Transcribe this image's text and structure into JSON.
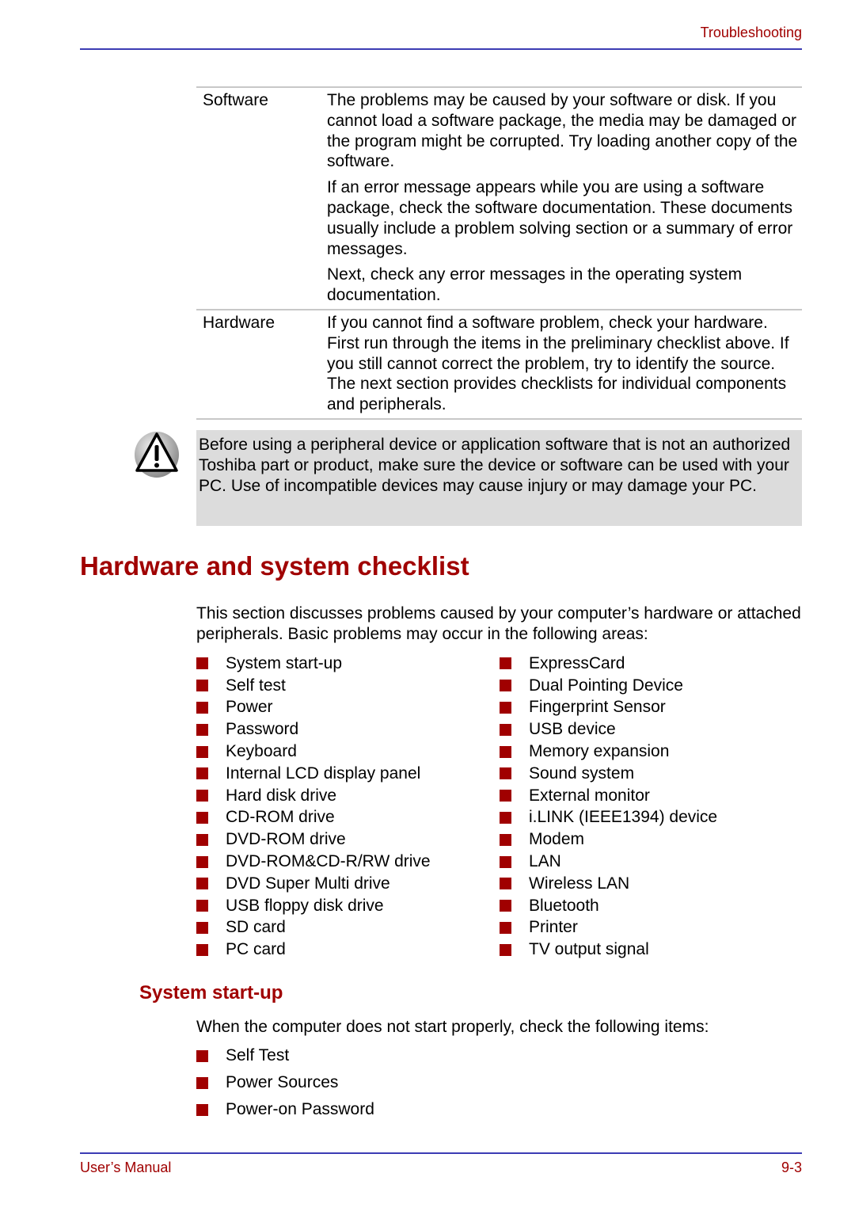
{
  "header": {
    "section_title": "Troubleshooting"
  },
  "table": {
    "rows": [
      {
        "label": "Software",
        "paragraphs": [
          "The problems may be caused by your software or disk. If you cannot load a software package, the media may be damaged or the program might be corrupted. Try loading another copy of the software.",
          "If an error message appears while you are using a software package, check the software documentation. These documents usually include a problem solving section or a summary of error messages.",
          "Next, check any error messages in the operating system documentation."
        ]
      },
      {
        "label": "Hardware",
        "paragraphs": [
          "If you cannot find a software problem, check your hardware. First run through the items in the preliminary checklist above. If you still cannot correct the problem, try to identify the source. The next section provides checklists for individual components and peripherals."
        ]
      }
    ]
  },
  "warning": {
    "icon": "warning-triangle-icon",
    "text": "Before using a peripheral device or application software that is not an authorized Toshiba part or product, make sure the device or software can be used with your PC. Use of incompatible devices may cause injury or may damage your PC."
  },
  "section": {
    "title": "Hardware and system checklist",
    "intro": "This section discusses problems caused by your computer’s hardware or attached peripherals. Basic problems may occur in the following areas:",
    "left_items": [
      "System start-up",
      "Self test",
      "Power",
      "Password",
      "Keyboard",
      "Internal LCD display panel",
      "Hard disk drive",
      "CD-ROM drive",
      "DVD-ROM drive",
      "DVD-ROM&CD-R/RW drive",
      "DVD Super Multi drive",
      "USB floppy disk drive",
      "SD card",
      "PC card"
    ],
    "right_items": [
      "ExpressCard",
      "Dual Pointing Device",
      "Fingerprint Sensor",
      "USB device",
      "Memory expansion",
      "Sound system",
      "External monitor",
      "i.LINK (IEEE1394) device",
      "Modem",
      "LAN",
      "Wireless LAN",
      "Bluetooth",
      "Printer",
      "TV output signal"
    ]
  },
  "subsection": {
    "title": "System start-up",
    "intro": "When the computer does not start properly, check the following items:",
    "items": [
      "Self Test",
      "Power Sources",
      "Power-on Password"
    ]
  },
  "footer": {
    "left": "User’s Manual",
    "page": "9-3"
  },
  "colors": {
    "accent": "#a00000",
    "rule": "#3c3cb4",
    "note_bg": "#dcdcdc"
  }
}
